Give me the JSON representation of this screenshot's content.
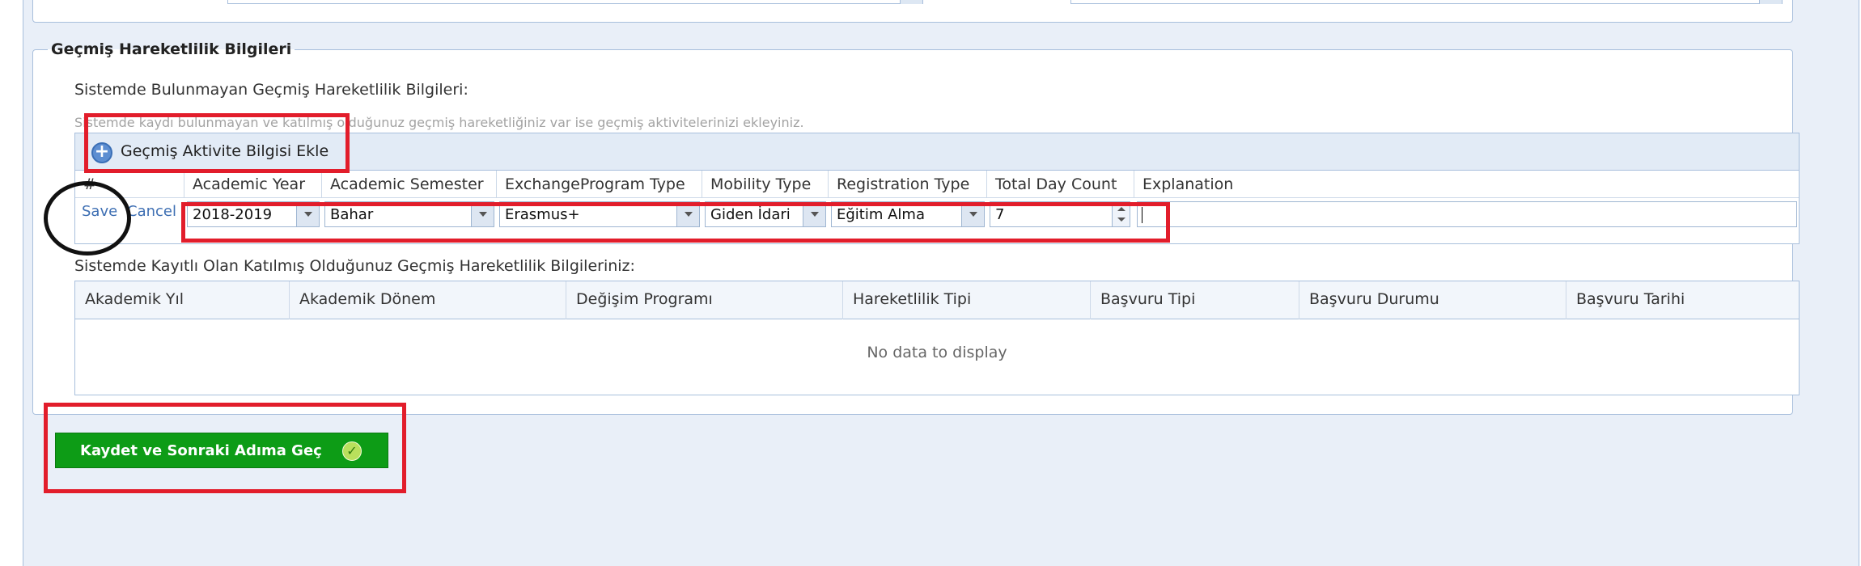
{
  "panel": {
    "title": "Geçmiş Hareketlilik Bilgileri",
    "section1_label": "Sistemde Bulunmayan Geçmiş Hareketlilik Bilgileri:",
    "hint_text": "Sistemde kaydı bulunmayan ve katılmış olduğunuz geçmiş hareketliğiniz var ise geçmiş aktivitelerinizi ekleyiniz.",
    "section2_label": "Sistemde Kayıtlı Olan Katılmış Olduğunuz Geçmiş Hareketlilik Bilgileriniz:"
  },
  "grid1": {
    "add_button_label": "Geçmiş Aktivite Bilgisi Ekle",
    "add_icon": "plus-circle-icon",
    "headers": [
      "#",
      "Academic Year",
      "Academic Semester",
      "ExchangeProgram Type",
      "Mobility Type",
      "Registration Type",
      "Total Day Count",
      "Explanation"
    ],
    "edit_row": {
      "save": "Save",
      "cancel": "Cancel",
      "academic_year": "2018-2019",
      "academic_semester": "Bahar",
      "exchange_program_type": "Erasmus+",
      "mobility_type": "Giden İdari",
      "registration_type": "Eğitim Alma",
      "total_day_count": "7",
      "explanation": ""
    }
  },
  "grid2": {
    "headers": [
      "Akademik Yıl",
      "Akademik Dönem",
      "Değişim Programı",
      "Hareketlilik Tipi",
      "Başvuru Tipi",
      "Başvuru Durumu",
      "Başvuru Tarihi"
    ],
    "empty_text": "No data to display"
  },
  "footer": {
    "save_next_label": "Kaydet ve Sonraki Adıma Geç",
    "save_next_icon": "check-circle-icon"
  },
  "colors": {
    "accent_green": "#0d9c16",
    "annotation_red": "#e21d2b",
    "border_blue": "#a8bfdc"
  }
}
